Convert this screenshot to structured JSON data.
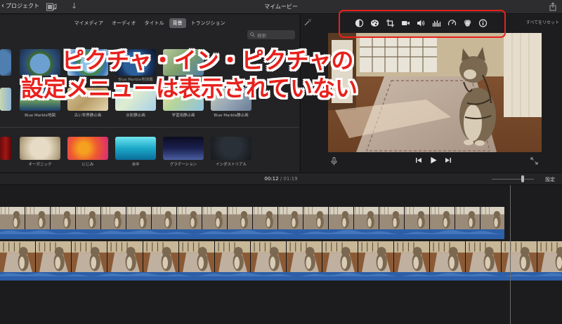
{
  "titlebar": {
    "back_label": "プロジェクト",
    "title": "マイムービー"
  },
  "browser": {
    "tabs": [
      {
        "label": "マイメディア",
        "active": false
      },
      {
        "label": "オーディオ",
        "active": false
      },
      {
        "label": "タイトル",
        "active": false
      },
      {
        "label": "背景",
        "active": true
      },
      {
        "label": "トランジション",
        "active": false
      }
    ],
    "search_placeholder": "検索",
    "row1_labels": [
      "",
      "",
      "",
      "",
      ""
    ],
    "row2_labels": [
      "",
      "Blue Marble地図",
      "古い世界静止画",
      "水彩静止画",
      "学習用静止画",
      "Blue Marble静止画"
    ],
    "row3_labels": [
      "",
      "オーガニック",
      "にじみ",
      "水中",
      "グラデーション",
      "インダストリアル"
    ],
    "overlay_label_partial": "Blue Marble地球儀"
  },
  "viewer": {
    "reset_all": "すべてをリセット",
    "tools": [
      "color-balance-icon",
      "color-correction-icon",
      "crop-icon",
      "stabilization-icon",
      "volume-icon",
      "noise-reduction-icon",
      "speed-icon",
      "clip-filter-icon",
      "info-icon"
    ]
  },
  "timeline": {
    "current_time": "00:12",
    "separator": "/",
    "total_time": "01:19",
    "settings_label": "設定"
  },
  "caption": {
    "line1": "ピクチャ・イン・ピクチャの",
    "line2": "設定メニューは表示されていない"
  },
  "colors": {
    "accent_red": "#e8201c",
    "audio_blue": "#2c5fa8"
  }
}
